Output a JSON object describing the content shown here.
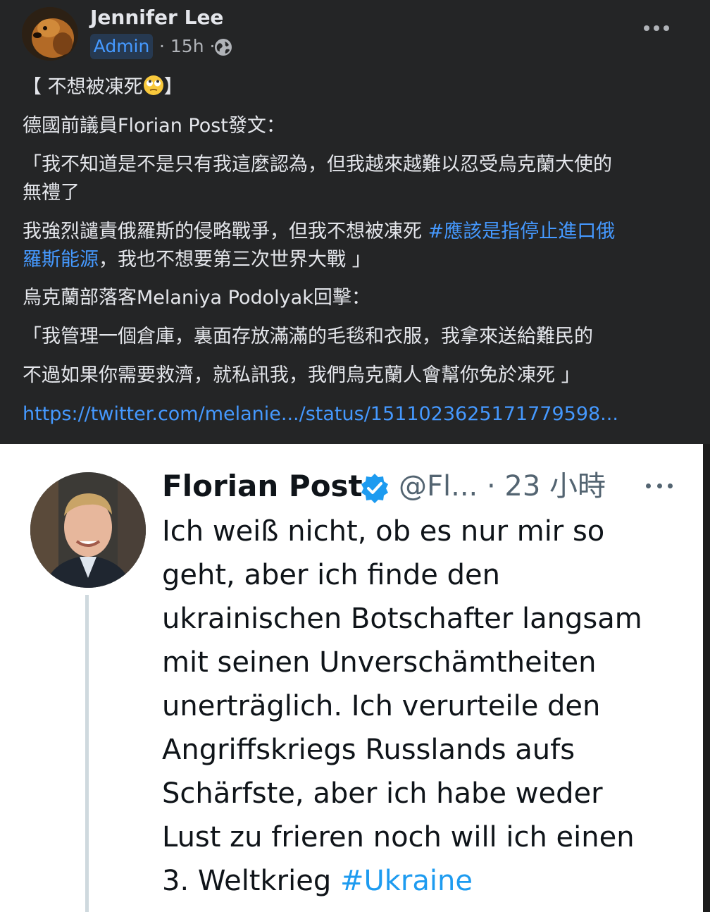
{
  "post": {
    "author": "Jennifer Lee",
    "role_badge": "Admin",
    "time": "· 15h ·",
    "lines": {
      "title_a": "【 不想被凍死",
      "title_b": "】",
      "l1": "德國前議員Florian Post發文：",
      "l2": "「我不知道是不是只有我這麼認為，但我越來越難以忍受烏克蘭大使的",
      "l3": "無禮了",
      "l4": "我強烈譴責俄羅斯的侵略戰爭，但我不想被凍死 ",
      "l4_tag": "#應該是指停止進口俄",
      "l5_tag": "羅斯能源",
      "l5": "，我也不想要第三次世界大戰 」",
      "l6": "烏克蘭部落客Melaniya Podolyak回擊：",
      "l7": "「我管理一個倉庫，裏面存放滿滿的毛毯和衣服，我拿來送給難民的",
      "l8": "不過如果你需要救濟，就私訊我，我們烏克蘭人會幫你免於凍死 」",
      "link": "https://twitter.com/melanie.../status/1511023625171779598..."
    },
    "emoji": "face-with-rolling-eyes",
    "colors": {
      "background": "#242526",
      "text": "#e4e6eb",
      "link": "#4599ff"
    }
  },
  "tweet": {
    "name": "Florian Post",
    "handle_time": "@Fl... · 23 小時",
    "lines": [
      "Ich weiß nicht, ob es nur mir so",
      "geht, aber ich finde den",
      "ukrainischen Botschafter langsam",
      "mit seinen Unverschämtheiten",
      "unerträglich. Ich verurteile den",
      "Angriffskriegs Russlands aufs",
      "Schärfste, aber ich habe weder",
      "Lust zu frieren noch will ich einen"
    ],
    "last_line": "3. Weltkrieg ",
    "hashtag": "#Ukraine",
    "colors": {
      "hashtag": "#1d9bf0",
      "verified": "#1d9bf0"
    }
  }
}
